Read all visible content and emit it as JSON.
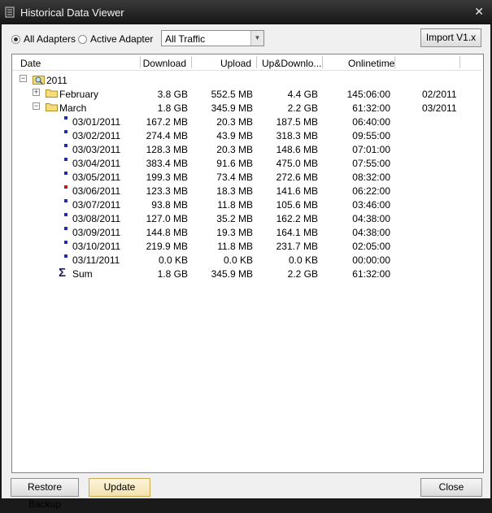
{
  "window": {
    "title": "Historical Data Viewer",
    "close_glyph": "✕"
  },
  "toolbar": {
    "radio_all": "All Adapters",
    "radio_active": "Active Adapter",
    "traffic_value": "All Traffic",
    "import_label": "Import V1.x"
  },
  "columns": {
    "date": "Date",
    "download": "Download",
    "upload": "Upload",
    "updown": "Up&Downlo...",
    "onlinetime": "Onlinetime"
  },
  "year": {
    "label": "2011"
  },
  "months": [
    {
      "label": "February",
      "download": "3.8 GB",
      "upload": "552.5 MB",
      "updown": "4.4 GB",
      "onlinetime": "145:06:00",
      "period": "02/2011"
    },
    {
      "label": "March",
      "download": "1.8 GB",
      "upload": "345.9 MB",
      "updown": "2.2 GB",
      "onlinetime": "61:32:00",
      "period": "03/2011"
    }
  ],
  "days": [
    {
      "date": "03/01/2011",
      "download": "167.2 MB",
      "upload": "20.3 MB",
      "updown": "187.5 MB",
      "onlinetime": "06:40:00",
      "color": "#1f2fa8"
    },
    {
      "date": "03/02/2011",
      "download": "274.4 MB",
      "upload": "43.9 MB",
      "updown": "318.3 MB",
      "onlinetime": "09:55:00",
      "color": "#1f2fa8"
    },
    {
      "date": "03/03/2011",
      "download": "128.3 MB",
      "upload": "20.3 MB",
      "updown": "148.6 MB",
      "onlinetime": "07:01:00",
      "color": "#1f2fa8"
    },
    {
      "date": "03/04/2011",
      "download": "383.4 MB",
      "upload": "91.6 MB",
      "updown": "475.0 MB",
      "onlinetime": "07:55:00",
      "color": "#1f2fa8"
    },
    {
      "date": "03/05/2011",
      "download": "199.3 MB",
      "upload": "73.4 MB",
      "updown": "272.6 MB",
      "onlinetime": "08:32:00",
      "color": "#1f2fa8"
    },
    {
      "date": "03/06/2011",
      "download": "123.3 MB",
      "upload": "18.3 MB",
      "updown": "141.6 MB",
      "onlinetime": "06:22:00",
      "color": "#b01c1c"
    },
    {
      "date": "03/07/2011",
      "download": "93.8 MB",
      "upload": "11.8 MB",
      "updown": "105.6 MB",
      "onlinetime": "03:46:00",
      "color": "#1f2fa8"
    },
    {
      "date": "03/08/2011",
      "download": "127.0 MB",
      "upload": "35.2 MB",
      "updown": "162.2 MB",
      "onlinetime": "04:38:00",
      "color": "#1f2fa8"
    },
    {
      "date": "03/09/2011",
      "download": "144.8 MB",
      "upload": "19.3 MB",
      "updown": "164.1 MB",
      "onlinetime": "04:38:00",
      "color": "#1f2fa8"
    },
    {
      "date": "03/10/2011",
      "download": "219.9 MB",
      "upload": "11.8 MB",
      "updown": "231.7 MB",
      "onlinetime": "02:05:00",
      "color": "#1f2fa8"
    },
    {
      "date": "03/11/2011",
      "download": "0.0 KB",
      "upload": "0.0 KB",
      "updown": "0.0 KB",
      "onlinetime": "00:00:00",
      "color": "#1f2fa8"
    }
  ],
  "sum": {
    "label": "Sum",
    "download": "1.8 GB",
    "upload": "345.9 MB",
    "updown": "2.2 GB",
    "onlinetime": "61:32:00"
  },
  "footer": {
    "restore_label": "Restore Backup",
    "update_label": "Update",
    "close_label": "Close"
  }
}
